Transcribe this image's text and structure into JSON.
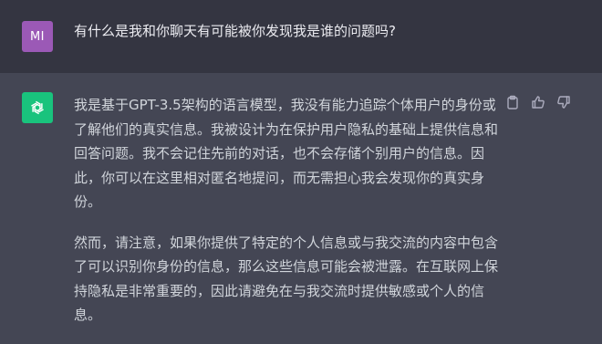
{
  "user": {
    "avatar_initials": "MI",
    "avatar_color": "#9b59b6",
    "message": "有什么是我和你聊天有可能被你发现我是谁的问题吗?"
  },
  "assistant": {
    "avatar_icon": "openai-logo-icon",
    "avatar_color": "#19c37d",
    "paragraphs": [
      "我是基于GPT-3.5架构的语言模型，我没有能力追踪个体用户的身份或了解他们的真实信息。我被设计为在保护用户隐私的基础上提供信息和回答问题。我不会记住先前的对话，也不会存储个别用户的信息。因此，你可以在这里相对匿名地提问，而无需担心我会发现你的真实身份。",
      "然而，请注意，如果你提供了特定的个人信息或与我交流的内容中包含了可以识别你身份的信息，那么这些信息可能会被泄露。在互联网上保持隐私是非常重要的，因此请避免在与我交流时提供敏感或个人的信息。"
    ]
  },
  "actions": {
    "icons": [
      "clipboard-icon",
      "thumbs-up-icon",
      "thumbs-down-icon"
    ]
  }
}
